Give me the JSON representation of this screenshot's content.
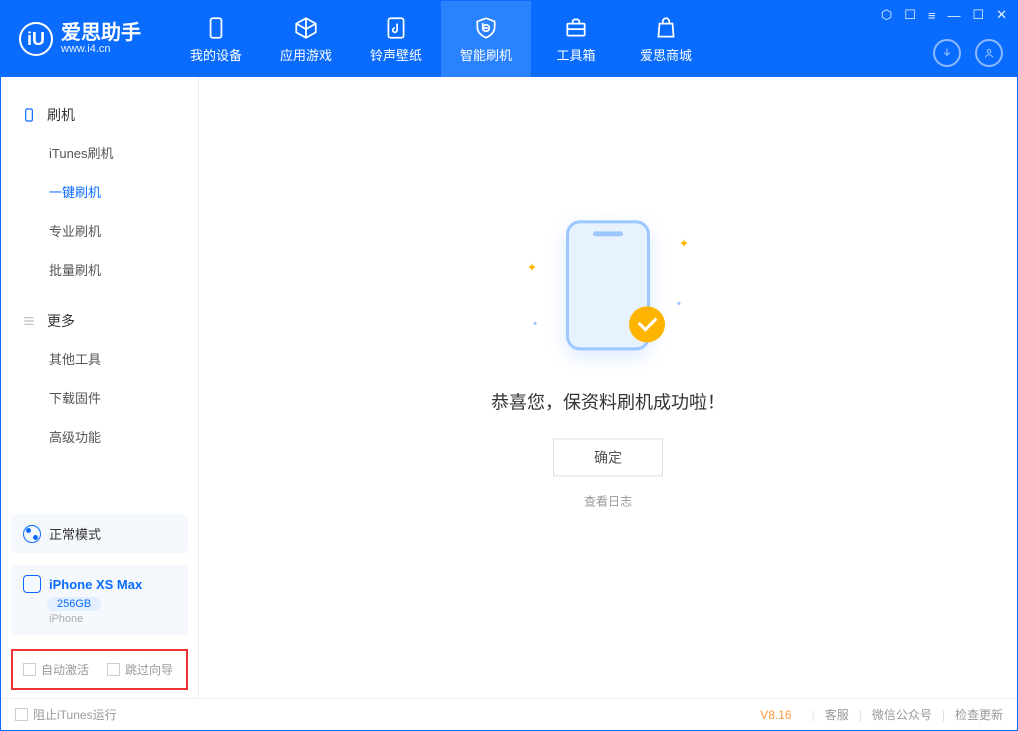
{
  "app": {
    "title": "爱思助手",
    "subtitle": "www.i4.cn"
  },
  "tabs": [
    {
      "id": "device",
      "label": "我的设备"
    },
    {
      "id": "apps",
      "label": "应用游戏"
    },
    {
      "id": "ringtone",
      "label": "铃声壁纸"
    },
    {
      "id": "flash",
      "label": "智能刷机",
      "active": true
    },
    {
      "id": "toolbox",
      "label": "工具箱"
    },
    {
      "id": "store",
      "label": "爱思商城"
    }
  ],
  "sidebar": {
    "group1": {
      "title": "刷机",
      "items": [
        "iTunes刷机",
        "一键刷机",
        "专业刷机",
        "批量刷机"
      ],
      "activeIndex": 1
    },
    "group2": {
      "title": "更多",
      "items": [
        "其他工具",
        "下载固件",
        "高级功能"
      ]
    }
  },
  "mode": {
    "label": "正常模式"
  },
  "device": {
    "name": "iPhone XS Max",
    "storage": "256GB",
    "type": "iPhone"
  },
  "checks": {
    "autoActivate": "自动激活",
    "skipGuide": "跳过向导"
  },
  "main": {
    "message": "恭喜您，保资料刷机成功啦！",
    "ok": "确定",
    "viewLog": "查看日志"
  },
  "footer": {
    "blockItunes": "阻止iTunes运行",
    "version": "V8.16",
    "links": [
      "客服",
      "微信公众号",
      "检查更新"
    ]
  }
}
